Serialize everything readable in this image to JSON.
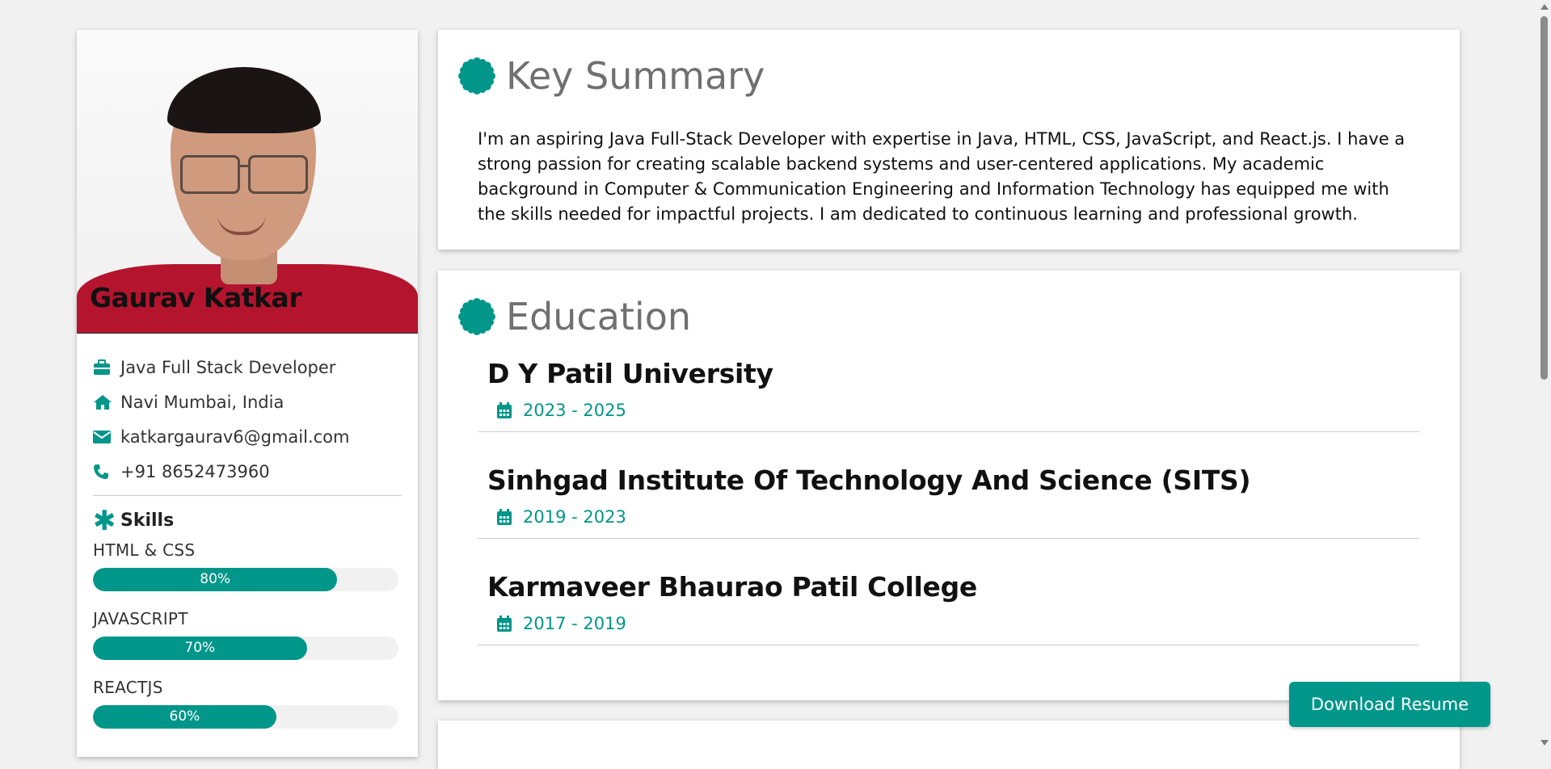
{
  "profile": {
    "name": "Gaurav Katkar",
    "title": "Java Full Stack Developer",
    "location": "Navi Mumbai, India",
    "email": "katkargaurav6@gmail.com",
    "phone": "+91 8652473960"
  },
  "skills": {
    "heading": "Skills",
    "items": [
      {
        "name": "HTML & CSS",
        "percent_label": "80%",
        "level": 0.8
      },
      {
        "name": "JAVASCRIPT",
        "percent_label": "70%",
        "level": 0.7
      },
      {
        "name": "REACTJS",
        "percent_label": "60%",
        "level": 0.6
      }
    ]
  },
  "summary": {
    "heading": "Key Summary",
    "text": "I'm an aspiring Java Full-Stack Developer with expertise in Java, HTML, CSS, JavaScript, and React.js. I have a strong passion for creating scalable backend systems and user-centered applications. My academic background in Computer & Communication Engineering and Information Technology has equipped me with the skills needed for impactful projects. I am dedicated to continuous learning and professional growth."
  },
  "education": {
    "heading": "Education",
    "items": [
      {
        "school": "D Y Patil University",
        "dates": "2023 - 2025"
      },
      {
        "school": "Sinhgad Institute Of Technology And Science (SITS)",
        "dates": "2019 - 2023"
      },
      {
        "school": "Karmaveer Bhaurao Patil College",
        "dates": "2017 - 2019"
      }
    ]
  },
  "actions": {
    "download_label": "Download Resume"
  },
  "colors": {
    "accent": "#00968a",
    "background": "#f1f1f1",
    "heading_gray": "#707070"
  },
  "icons": {
    "title": "briefcase-icon",
    "location": "home-icon",
    "email": "envelope-icon",
    "phone": "phone-icon",
    "skills": "asterisk-icon",
    "section": "certificate-icon",
    "dates": "calendar-icon"
  }
}
